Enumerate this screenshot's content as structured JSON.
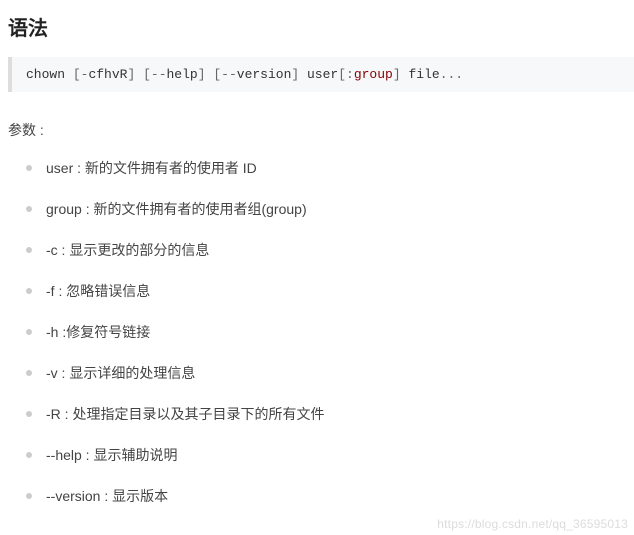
{
  "heading_syntax": "语法",
  "code": {
    "cmd": "chown ",
    "flags_open": "[",
    "flags_dash": "-",
    "flags_letters": "cfhvR",
    "flags_close": "]",
    "sp1": " ",
    "help_open": "[",
    "help_dashes": "--",
    "help_word": "help",
    "help_close": "]",
    "sp2": " ",
    "ver_open": "[",
    "ver_dashes": "--",
    "ver_word": "version",
    "ver_close": "]",
    "sp3": " ",
    "user_word": "user",
    "grp_open": "[:",
    "grp_word": "group",
    "grp_close": "]",
    "sp4": " ",
    "file_word": "file",
    "trail": "..."
  },
  "heading_params": "参数 :",
  "params": [
    "user : 新的文件拥有者的使用者 ID",
    "group : 新的文件拥有者的使用者组(group)",
    "-c : 显示更改的部分的信息",
    "-f : 忽略错误信息",
    "-h :修复符号链接",
    "-v : 显示详细的处理信息",
    "-R : 处理指定目录以及其子目录下的所有文件",
    "--help : 显示辅助说明",
    "--version : 显示版本"
  ],
  "watermark": "https://blog.csdn.net/qq_36595013"
}
